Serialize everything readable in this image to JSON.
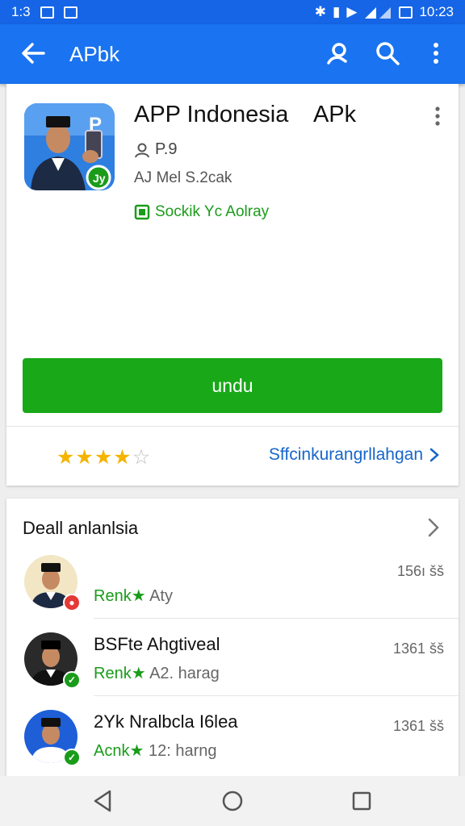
{
  "status_bar": {
    "time_left": "1:3",
    "time_right": "10:23"
  },
  "app_bar": {
    "title": "APbk"
  },
  "app": {
    "name": "APP Indonesia    APk",
    "meta1": "P.9",
    "meta2": "AJ  Mel S.2cak",
    "safe_label": "Sockik Yc Aolray",
    "install_label": "undu",
    "rating_stars": 4,
    "rating_max": 5,
    "reviews_link": "Sffcinkurangrllahgan"
  },
  "section": {
    "title": "Deall anlanlsia",
    "items": [
      {
        "name": "",
        "sub_green": "Renk★",
        "sub_gray": " Aty",
        "size": "156ı šš",
        "badge": "red"
      },
      {
        "name": "BSFte Ahgtiveal",
        "sub_green": "Renk★",
        "sub_gray": " A2. harag",
        "size": "1361 šš",
        "badge": "green"
      },
      {
        "name": "2Yk Nralbcla I6lea",
        "sub_green": "Acnk★",
        "sub_gray": " 12: harng",
        "size": "1361 šš",
        "badge": "green"
      }
    ]
  },
  "colors": {
    "appbar": "#1a73f0",
    "install": "#18a818",
    "link": "#1666c9",
    "star": "#f4b400"
  }
}
